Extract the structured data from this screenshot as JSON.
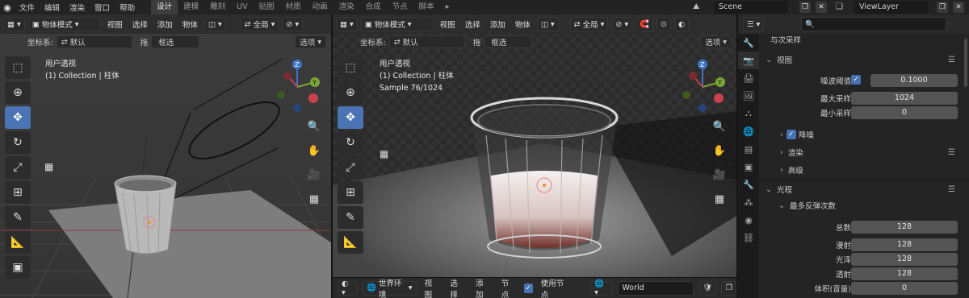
{
  "topbar": {
    "menus": [
      "文件",
      "编辑",
      "渲染",
      "窗口",
      "帮助"
    ],
    "workspaces": [
      "设计",
      "建模",
      "雕刻",
      "UV",
      "贴图",
      "材质",
      "动画",
      "渲染",
      "合成",
      "节点",
      "脚本"
    ],
    "active_workspace": "设计",
    "scene": "Scene",
    "view_layer": "ViewLayer"
  },
  "left_viewport": {
    "mode": "物体模式",
    "menus": [
      "视图",
      "选择",
      "添加",
      "物体"
    ],
    "transform": "全局",
    "coord_label": "坐标系:",
    "coord_value": "默认",
    "drag_label": "拖",
    "drag_value": "框选",
    "options": "选项",
    "view_name": "用户透视",
    "collection": "(1) Collection | 柱体"
  },
  "right_viewport": {
    "mode": "物体模式",
    "menus": [
      "视图",
      "选择",
      "添加",
      "物体"
    ],
    "transform": "全局",
    "coord_label": "坐标系:",
    "coord_value": "默认",
    "drag_label": "拖",
    "drag_value": "框选",
    "options": "选项",
    "view_name": "用户透视",
    "collection": "(1) Collection | 柱体",
    "sample": "Sample 76/1024"
  },
  "node_header": {
    "world_env": "世界环境",
    "menus": [
      "视图",
      "选择",
      "添加",
      "节点"
    ],
    "use_nodes": "使用节点",
    "world": "World"
  },
  "gizmo": {
    "x": "X",
    "y": "Y",
    "z": "Z"
  },
  "properties": {
    "top_section": "与次采样",
    "viewport_section": "视图",
    "noise_threshold_label": "噪波阈值",
    "noise_threshold_value": "0.1000",
    "max_samples_label": "最大采样",
    "max_samples_value": "1024",
    "min_samples_label": "最小采样",
    "min_samples_value": "0",
    "denoise": "降噪",
    "render": "渲染",
    "advanced": "高级",
    "light_paths": "光程",
    "max_bounces": "最多反弹次数",
    "total_label": "总数",
    "total_value": "128",
    "diffuse_label": "漫射",
    "diffuse_value": "128",
    "glossy_label": "光泽",
    "glossy_value": "128",
    "transmission_label": "透射",
    "transmission_value": "128",
    "volume_label": "体积(音量)",
    "volume_value": "0"
  },
  "colors": {
    "accent": "#4772b3",
    "x_axis": "#c9414f",
    "y_axis": "#7ba634",
    "z_axis": "#3d75c4"
  }
}
